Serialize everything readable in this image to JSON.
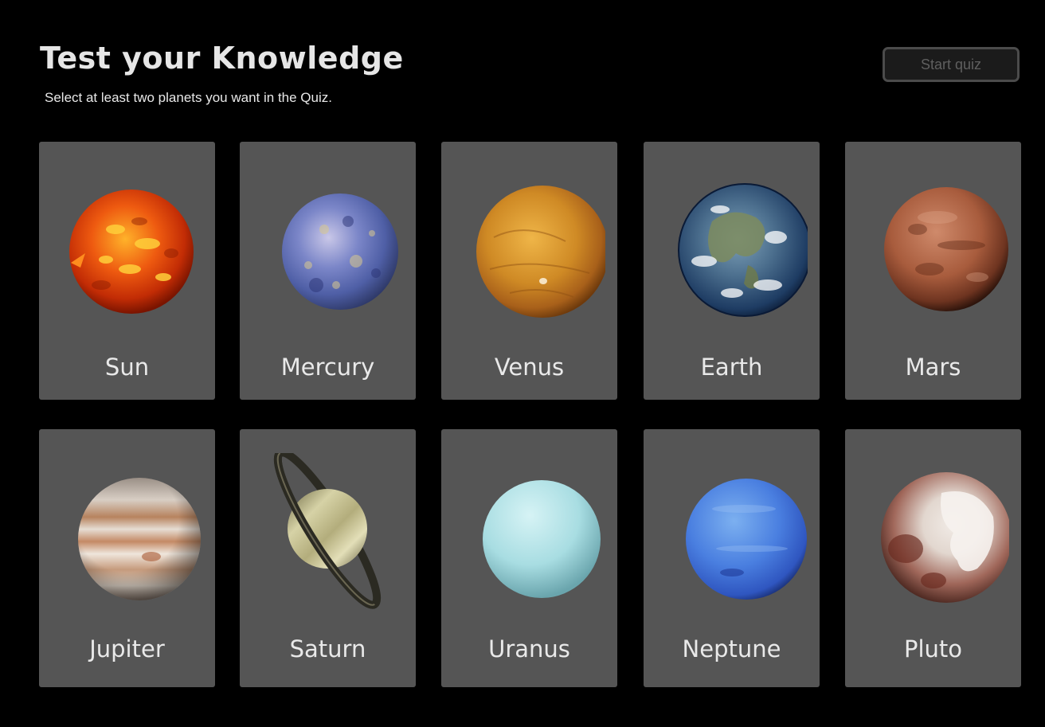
{
  "header": {
    "title": "Test your Knowledge",
    "subtitle": "Select at least two planets you want in the Quiz.",
    "start_label": "Start quiz"
  },
  "planets": [
    {
      "name": "Sun"
    },
    {
      "name": "Mercury"
    },
    {
      "name": "Venus"
    },
    {
      "name": "Earth"
    },
    {
      "name": "Mars"
    },
    {
      "name": "Jupiter"
    },
    {
      "name": "Saturn"
    },
    {
      "name": "Uranus"
    },
    {
      "name": "Neptune"
    },
    {
      "name": "Pluto"
    }
  ],
  "colors": {
    "background": "#000000",
    "card": "#555555",
    "button_border": "#4b4b4b",
    "button_text": "#5f5f5f"
  }
}
